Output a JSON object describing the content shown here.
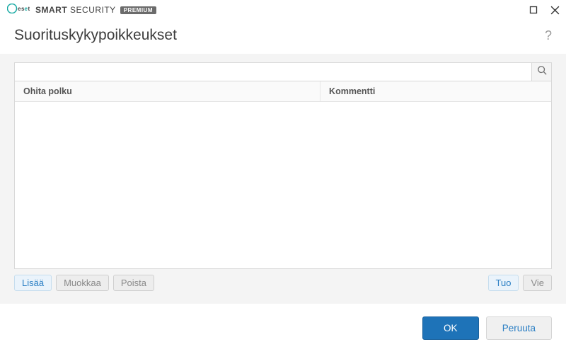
{
  "brand": {
    "name_part1": "SMART",
    "name_part2": "SECURITY",
    "badge": "PREMIUM"
  },
  "page": {
    "title": "Suorituskykypoikkeukset"
  },
  "search": {
    "value": "",
    "placeholder": ""
  },
  "table": {
    "columns": {
      "path": "Ohita polku",
      "comment": "Kommentti"
    },
    "rows": []
  },
  "actions": {
    "add": "Lisää",
    "edit": "Muokkaa",
    "delete": "Poista",
    "import": "Tuo",
    "export": "Vie"
  },
  "footer": {
    "ok": "OK",
    "cancel": "Peruuta"
  }
}
